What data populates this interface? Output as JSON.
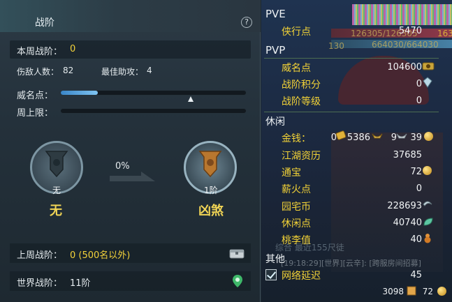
{
  "left": {
    "title": "战阶",
    "help": "?",
    "week_rank_label": "本周战阶：",
    "week_rank_value": "0",
    "kills_label": "伤敌人数：",
    "kills_value": "82",
    "assist_label": "最佳助攻：",
    "assist_value": "4",
    "fame_label": "威名点：",
    "fame_progress": 0.2,
    "week_cap_label": "周上限：",
    "current_rank_level": "无",
    "current_rank_name": "无",
    "progress_pct": "0%",
    "next_rank_level": "1阶",
    "next_rank_name": "凶煞",
    "last_week_label": "上周战阶：",
    "last_week_value": "0 (500名以外)",
    "world_label": "世界战阶：",
    "world_value": "11阶"
  },
  "right": {
    "pve_head": "PVE",
    "pve_items": [
      {
        "label": "侠行点",
        "value": "5470"
      }
    ],
    "overlay_hp": "126305/126305",
    "overlay_mp": "664030/664030",
    "overlay_lv": "130",
    "overlay_163": "163",
    "pvp_head": "PVP",
    "pvp_items": [
      {
        "label": "威名点",
        "value": "104600"
      },
      {
        "label": "战阶积分",
        "value": "0"
      },
      {
        "label": "战阶等级",
        "value": "0"
      }
    ],
    "leisure_head": "休闲",
    "money_label": "金钱：",
    "money_gold": "0",
    "money_silver": "5386",
    "money_copper": "9",
    "money_other": "39",
    "leisure_items": [
      {
        "label": "江湖资历",
        "value": "37685"
      },
      {
        "label": "通宝",
        "value": "72"
      },
      {
        "label": "薪火点",
        "value": "0"
      },
      {
        "label": "园宅币",
        "value": "228693"
      },
      {
        "label": "休闲点",
        "value": "40740"
      },
      {
        "label": "桃李值",
        "value": "40"
      }
    ],
    "other_head": "其他",
    "other_items": [
      {
        "label": "网络延迟",
        "value": "45"
      }
    ],
    "chat_overlay_1": "综合    最近155尺徒",
    "chat_overlay_2": "[19:18:29][世界][云辛]: [跨服房间招募]",
    "bottom_left": "3098",
    "bottom_right": "72"
  }
}
